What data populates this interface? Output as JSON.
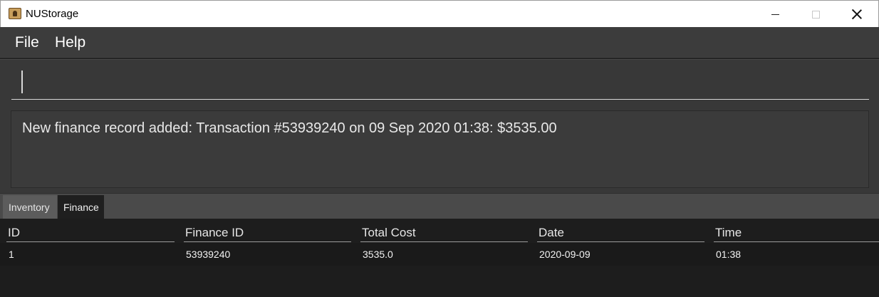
{
  "window": {
    "title": "NUStorage",
    "app_icon": "nustorage-app-icon"
  },
  "menu": {
    "items": [
      "File",
      "Help"
    ]
  },
  "command_box": {
    "value": ""
  },
  "result_display": {
    "message": "New finance record added: Transaction #53939240 on 09 Sep 2020 01:38: $3535.00"
  },
  "tabs": [
    {
      "label": "Inventory",
      "selected": false
    },
    {
      "label": "Finance",
      "selected": true
    }
  ],
  "table": {
    "columns": [
      "ID",
      "Finance ID",
      "Total Cost",
      "Date",
      "Time"
    ],
    "rows": [
      [
        "1",
        "53939240",
        "3535.0",
        "2020-09-09",
        "01:38"
      ]
    ]
  },
  "colors": {
    "background_dark": "#1e1e1e",
    "panel": "#383838",
    "menu": "#3c3c3c",
    "text": "#ffffff"
  }
}
